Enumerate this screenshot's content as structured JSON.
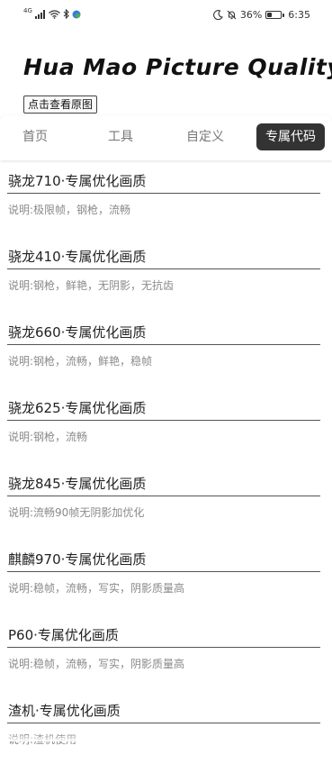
{
  "status_bar": {
    "network_label": "4G",
    "battery_percent": "36%",
    "battery_level": 0.36,
    "time": "6:35",
    "icons": [
      "signal-icon",
      "wifi-icon",
      "bluetooth-icon",
      "app-notification-icon",
      "moon-icon",
      "bell-off-icon",
      "battery-icon"
    ]
  },
  "header": {
    "title": "Hua Mao Picture Quality",
    "view_original_label": "点击查看原图"
  },
  "tabs": [
    {
      "label": "首页",
      "active": false
    },
    {
      "label": "工具",
      "active": false
    },
    {
      "label": "自定义",
      "active": false
    },
    {
      "label": "专属代码",
      "active": true
    }
  ],
  "items": [
    {
      "title": "骁龙710·专属优化画质",
      "desc": "说明:极限帧，钢枪，流畅"
    },
    {
      "title": "骁龙410·专属优化画质",
      "desc": "说明:钢枪，鲜艳，无阴影，无抗齿"
    },
    {
      "title": "骁龙660·专属优化画质",
      "desc": "说明:钢枪，流畅，鲜艳，稳帧"
    },
    {
      "title": "骁龙625·专属优化画质",
      "desc": "说明:钢枪，流畅"
    },
    {
      "title": "骁龙845·专属优化画质",
      "desc": "说明:流畅90帧无阴影加优化"
    },
    {
      "title": "麒麟970·专属优化画质",
      "desc": "说明:稳帧，流畅，写实，阴影质量高"
    },
    {
      "title": "P60·专属优化画质",
      "desc": "说明:稳帧，流畅，写实，阴影质量高"
    },
    {
      "title": "渣机·专属优化画质",
      "desc": "说明:渣机使用"
    }
  ],
  "colors": {
    "active_tab_bg": "#333333",
    "active_tab_text": "#ffffff",
    "inactive_tab_text": "#777777",
    "desc_text": "#8a8a8a"
  }
}
